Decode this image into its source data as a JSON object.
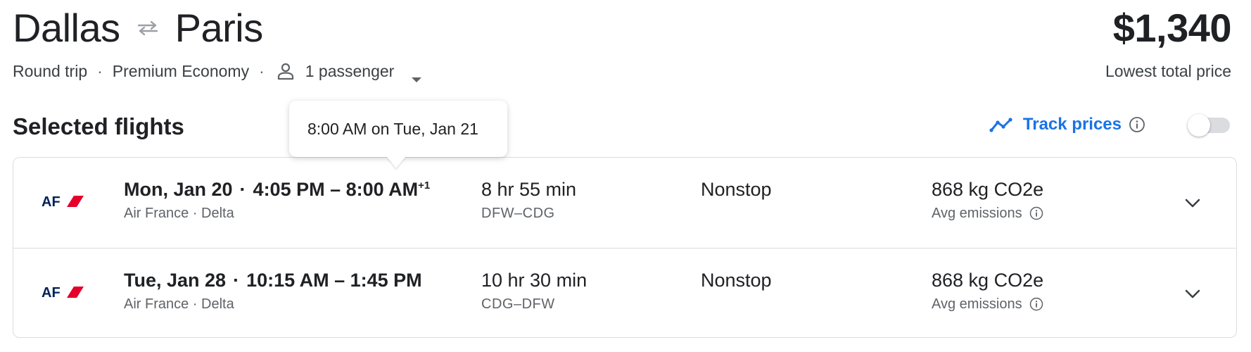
{
  "header": {
    "origin": "Dallas",
    "destination": "Paris",
    "trip_type": "Round trip",
    "cabin": "Premium Economy",
    "passengers": "1 passenger",
    "price": "$1,340",
    "price_label": "Lowest total price"
  },
  "section": {
    "title": "Selected flights",
    "track_prices_label": "Track prices",
    "track_prices_enabled": false
  },
  "tooltip": {
    "text": "8:00 AM on Tue, Jan 21"
  },
  "flights": [
    {
      "date": "Mon, Jan 20",
      "time_range": "4:05 PM – 8:00 AM",
      "day_offset": "+1",
      "carriers": "Air France · Delta",
      "duration": "8 hr 55 min",
      "airports": "DFW–CDG",
      "stops": "Nonstop",
      "emissions": "868 kg CO2e",
      "emissions_label": "Avg emissions"
    },
    {
      "date": "Tue, Jan 28",
      "time_range": "10:15 AM – 1:45 PM",
      "day_offset": "",
      "carriers": "Air France · Delta",
      "duration": "10 hr 30 min",
      "airports": "CDG–DFW",
      "stops": "Nonstop",
      "emissions": "868 kg CO2e",
      "emissions_label": "Avg emissions"
    }
  ],
  "airline_logo": "AF",
  "icons": {
    "swap": "swap-arrows-icon",
    "person": "person-icon",
    "dropdown": "caret-down-icon",
    "track": "trending-line-icon",
    "info": "info-icon",
    "expand": "chevron-down-icon"
  },
  "colors": {
    "accent": "#1a73e8",
    "airfrance_blue": "#002157",
    "airfrance_red": "#e4002b"
  }
}
